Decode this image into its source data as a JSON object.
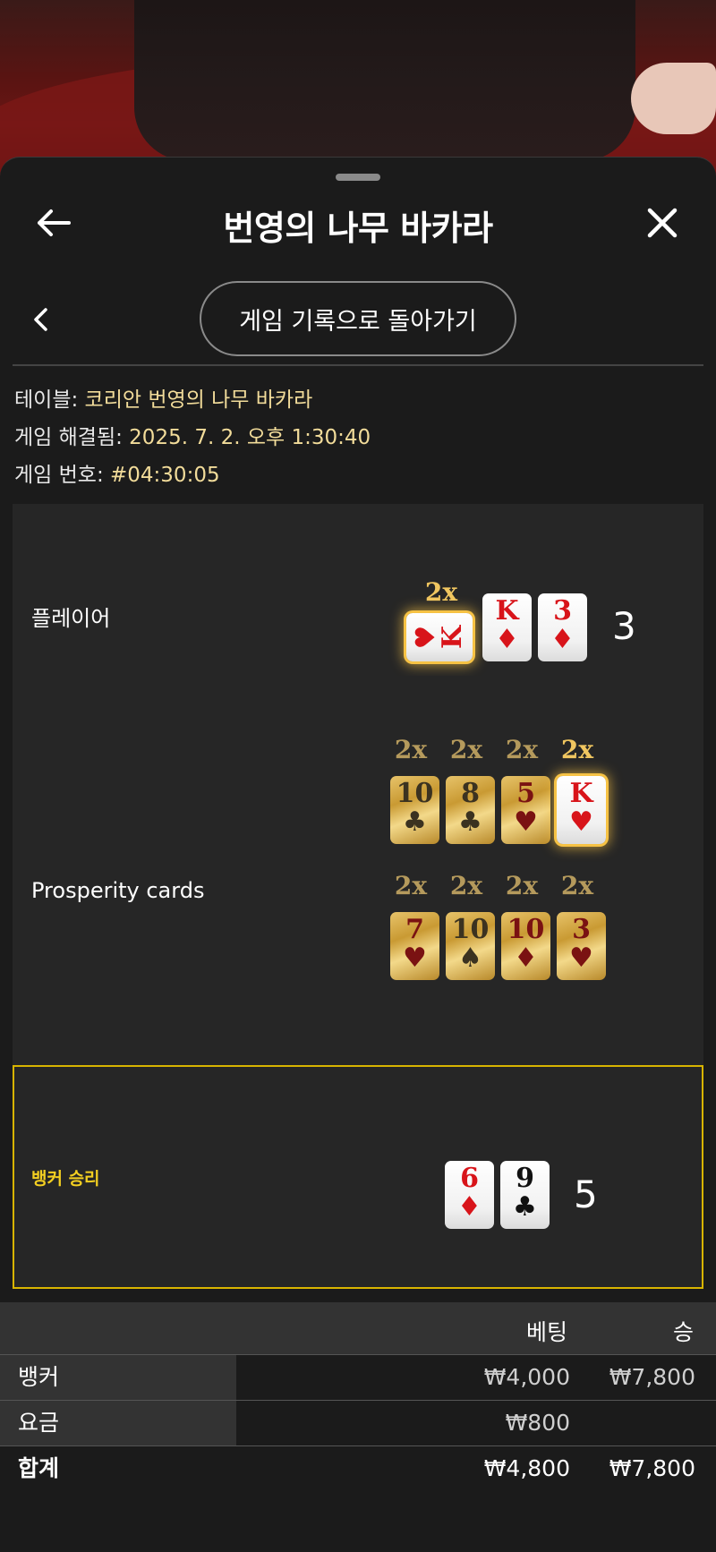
{
  "header": {
    "title": "번영의 나무 바카라",
    "back_icon": "arrow-left-icon",
    "close_icon": "close-icon"
  },
  "subnav": {
    "back_history_label": "게임 기록으로 돌아가기"
  },
  "meta": {
    "table_label": "테이블: ",
    "table_value": "코리안 번영의 나무 바카라",
    "resolved_label": "게임 해결됨: ",
    "resolved_value": "2025. 7. 2. 오후 1:30:40",
    "number_label": "게임 번호: ",
    "number_value": "#04:30:05"
  },
  "player": {
    "label": "플레이어",
    "multiplier": "2x",
    "cards": [
      {
        "rank": "K",
        "suit": "♥",
        "color": "red",
        "sideways": true,
        "highlight": true
      },
      {
        "rank": "K",
        "suit": "♦",
        "color": "red"
      },
      {
        "rank": "3",
        "suit": "♦",
        "color": "red"
      }
    ],
    "score": "3"
  },
  "prosperity": {
    "label": "Prosperity cards",
    "row1": [
      {
        "mult": "2x",
        "rank": "10",
        "suit": "♣",
        "color": "black",
        "active": false
      },
      {
        "mult": "2x",
        "rank": "8",
        "suit": "♣",
        "color": "black",
        "active": false
      },
      {
        "mult": "2x",
        "rank": "5",
        "suit": "♥",
        "color": "red",
        "active": false
      },
      {
        "mult": "2x",
        "rank": "K",
        "suit": "♥",
        "color": "red",
        "active": true
      }
    ],
    "row2": [
      {
        "mult": "2x",
        "rank": "7",
        "suit": "♥",
        "color": "red",
        "active": false
      },
      {
        "mult": "2x",
        "rank": "10",
        "suit": "♠",
        "color": "black",
        "active": false
      },
      {
        "mult": "2x",
        "rank": "10",
        "suit": "♦",
        "color": "red",
        "active": false
      },
      {
        "mult": "2x",
        "rank": "3",
        "suit": "♥",
        "color": "red",
        "active": false
      }
    ]
  },
  "banker": {
    "label": "뱅커 승리",
    "cards": [
      {
        "rank": "6",
        "suit": "♦",
        "color": "red"
      },
      {
        "rank": "9",
        "suit": "♣",
        "color": "black"
      }
    ],
    "score": "5"
  },
  "bets": {
    "col_bet": "베팅",
    "col_win": "승",
    "rows": [
      {
        "label": "뱅커",
        "bet": "₩4,000",
        "win": "₩7,800"
      },
      {
        "label": "요금",
        "bet": "₩800",
        "win": ""
      }
    ],
    "total": {
      "label": "합계",
      "bet": "₩4,800",
      "win": "₩7,800"
    }
  },
  "colors": {
    "accent_gold": "#f3cf21",
    "meta_value": "#f2dc9a",
    "panel": "#262626",
    "sheet": "#1b1b1b"
  }
}
